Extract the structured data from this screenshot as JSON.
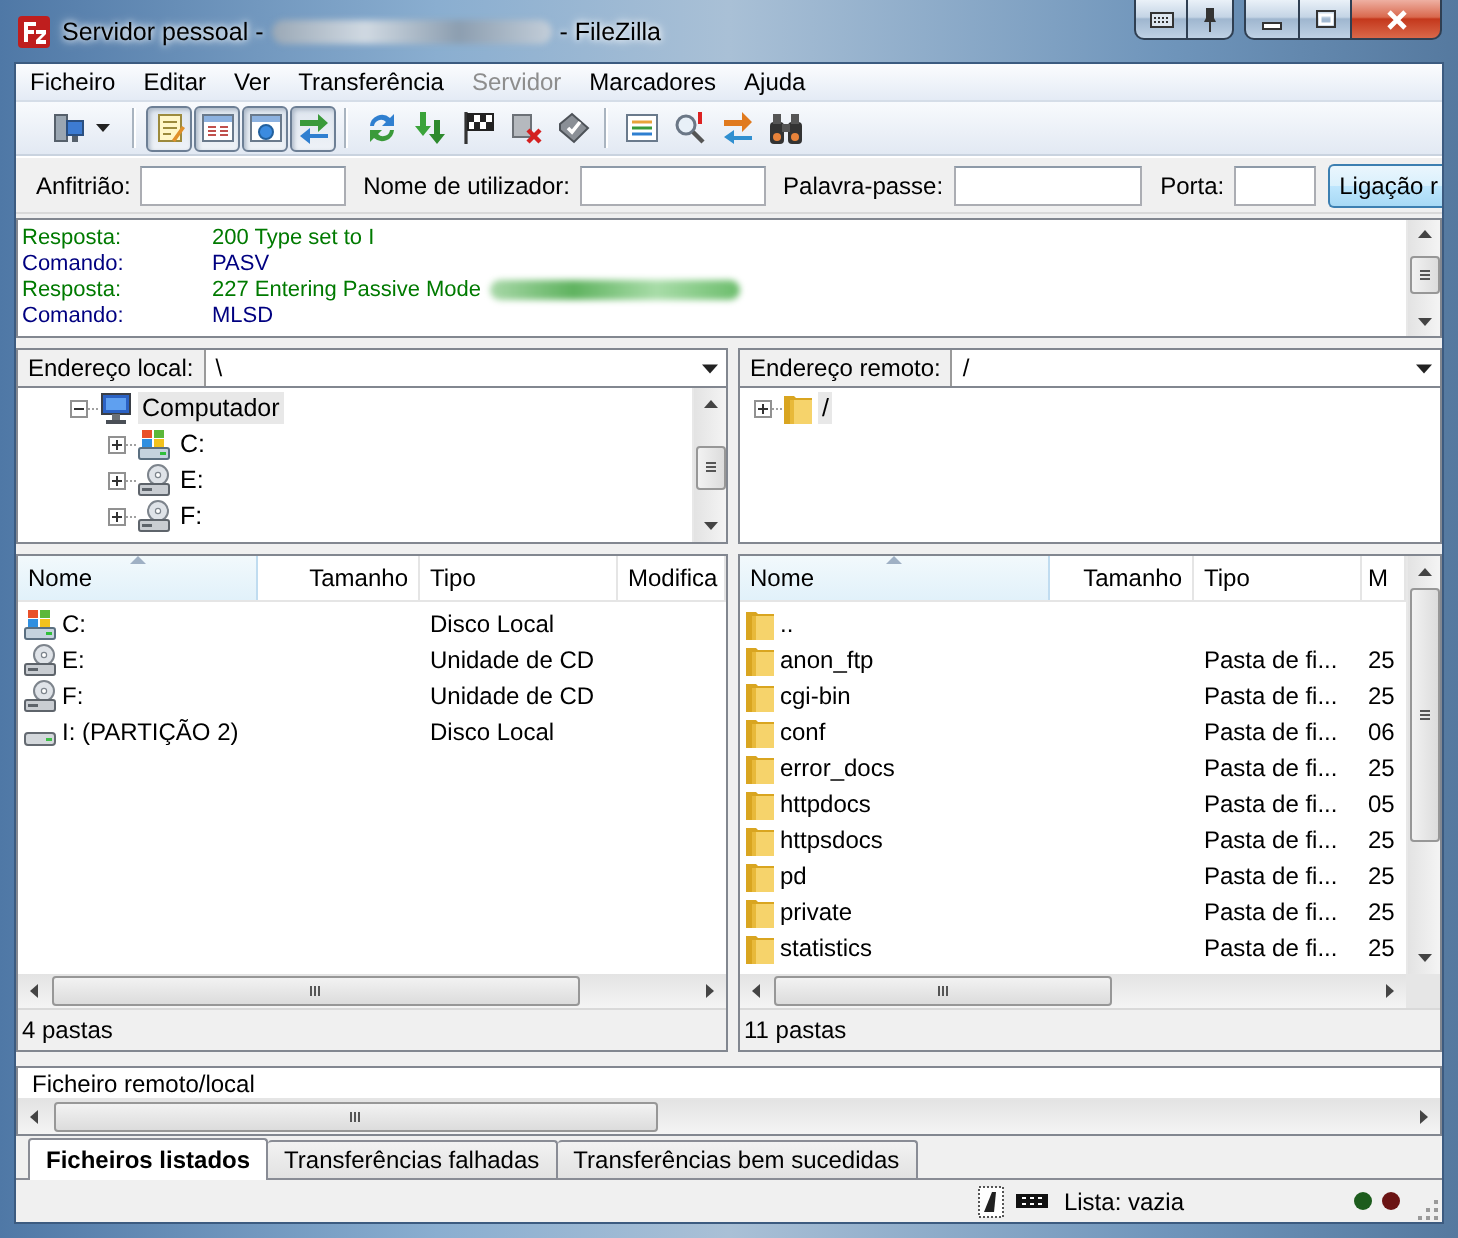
{
  "window": {
    "title": "Servidor pessoal -",
    "title_redacted": true,
    "app_name": "- FileZilla"
  },
  "menu": [
    {
      "label": "Ficheiro",
      "disabled": false
    },
    {
      "label": "Editar",
      "disabled": false
    },
    {
      "label": "Ver",
      "disabled": false
    },
    {
      "label": "Transferência",
      "disabled": false
    },
    {
      "label": "Servidor",
      "disabled": true
    },
    {
      "label": "Marcadores",
      "disabled": false
    },
    {
      "label": "Ajuda",
      "disabled": false
    }
  ],
  "toolbar": [
    {
      "pressed": false
    },
    {
      "pressed": true
    },
    {
      "pressed": true
    },
    {
      "pressed": true
    },
    {
      "pressed": true
    },
    {
      "pressed": false
    },
    {
      "pressed": false
    },
    {
      "pressed": false
    },
    {
      "pressed": false
    },
    {
      "pressed": false
    },
    {
      "pressed": false
    },
    {
      "pressed": false
    },
    {
      "pressed": false
    },
    {
      "pressed": false
    }
  ],
  "quickconnect": {
    "fields": [
      {
        "label": "Anfitrião:"
      },
      {
        "label": "Nome de utilizador:"
      },
      {
        "label": "Palavra-passe:"
      },
      {
        "label": "Porta:"
      }
    ],
    "button": "Ligação r"
  },
  "message_log": [
    {
      "kind": "response",
      "label": "Resposta:",
      "text": "200 Type set to I",
      "redacted": false
    },
    {
      "kind": "command",
      "label": "Comando:",
      "text": "PASV",
      "redacted": false
    },
    {
      "kind": "response",
      "label": "Resposta:",
      "text": "227 Entering Passive Mode",
      "redacted": true
    },
    {
      "kind": "command",
      "label": "Comando:",
      "text": "MLSD",
      "redacted": false
    }
  ],
  "local": {
    "address_label": "Endereço local:",
    "address": "\\",
    "tree": [
      {
        "label": "Computador",
        "kind": "computer",
        "expanded": true,
        "selected": true,
        "children": [
          {
            "label": "C:",
            "kind": "system",
            "expanded": false,
            "selected": false
          },
          {
            "label": "E:",
            "kind": "cd",
            "expanded": false,
            "selected": false
          },
          {
            "label": "F:",
            "kind": "cd",
            "expanded": false,
            "selected": false
          }
        ]
      }
    ],
    "columns": [
      {
        "label": "Nome",
        "sorted": true
      },
      {
        "label": "Tamanho",
        "sorted": false
      },
      {
        "label": "Tipo",
        "sorted": false
      },
      {
        "label": "Modifica",
        "sorted": false
      }
    ],
    "rows": [
      {
        "kind": "system",
        "name": "C:",
        "type": "Disco Local"
      },
      {
        "kind": "cd",
        "name": "E:",
        "type": "Unidade de CD"
      },
      {
        "kind": "cd",
        "name": "F:",
        "type": "Unidade de CD"
      },
      {
        "kind": "disk",
        "name": "I: (PARTIÇÃO 2)",
        "type": "Disco Local"
      }
    ],
    "status": "4 pastas"
  },
  "remote": {
    "address_label": "Endereço remoto:",
    "address": "/",
    "tree": [
      {
        "label": "/",
        "kind": "folder",
        "expanded": false,
        "selected": true
      }
    ],
    "columns": [
      {
        "label": "Nome",
        "sorted": true
      },
      {
        "label": "Tamanho",
        "sorted": false
      },
      {
        "label": "Tipo",
        "sorted": false
      },
      {
        "label": "M",
        "sorted": false
      }
    ],
    "rows": [
      {
        "kind": "folder",
        "name": ".."
      },
      {
        "kind": "folder",
        "name": "anon_ftp",
        "type": "Pasta de fi...",
        "column_4": "25"
      },
      {
        "kind": "folder",
        "name": "cgi-bin",
        "type": "Pasta de fi...",
        "column_4": "25"
      },
      {
        "kind": "folder",
        "name": "conf",
        "type": "Pasta de fi...",
        "column_4": "06"
      },
      {
        "kind": "folder",
        "name": "error_docs",
        "type": "Pasta de fi...",
        "column_4": "25"
      },
      {
        "kind": "folder",
        "name": "httpdocs",
        "type": "Pasta de fi...",
        "column_4": "05"
      },
      {
        "kind": "folder",
        "name": "httpsdocs",
        "type": "Pasta de fi...",
        "column_4": "25"
      },
      {
        "kind": "folder",
        "name": "pd",
        "type": "Pasta de fi...",
        "column_4": "25"
      },
      {
        "kind": "folder",
        "name": "private",
        "type": "Pasta de fi...",
        "column_4": "25"
      },
      {
        "kind": "folder",
        "name": "statistics",
        "type": "Pasta de fi...",
        "column_4": "25"
      }
    ],
    "status": "11 pastas"
  },
  "queue": {
    "columns": [
      {
        "label": "Ficheiro remoto/local"
      }
    ]
  },
  "tabs": [
    {
      "label": "Ficheiros listados",
      "selected": true
    },
    {
      "label": "Transferências falhadas",
      "selected": false
    },
    {
      "label": "Transferências bem sucedidas",
      "selected": false
    }
  ],
  "status_bar": {
    "text": "Lista: vazia",
    "lights": [
      {
        "color": "#1d5c1d"
      },
      {
        "color": "#6b1414"
      }
    ]
  }
}
